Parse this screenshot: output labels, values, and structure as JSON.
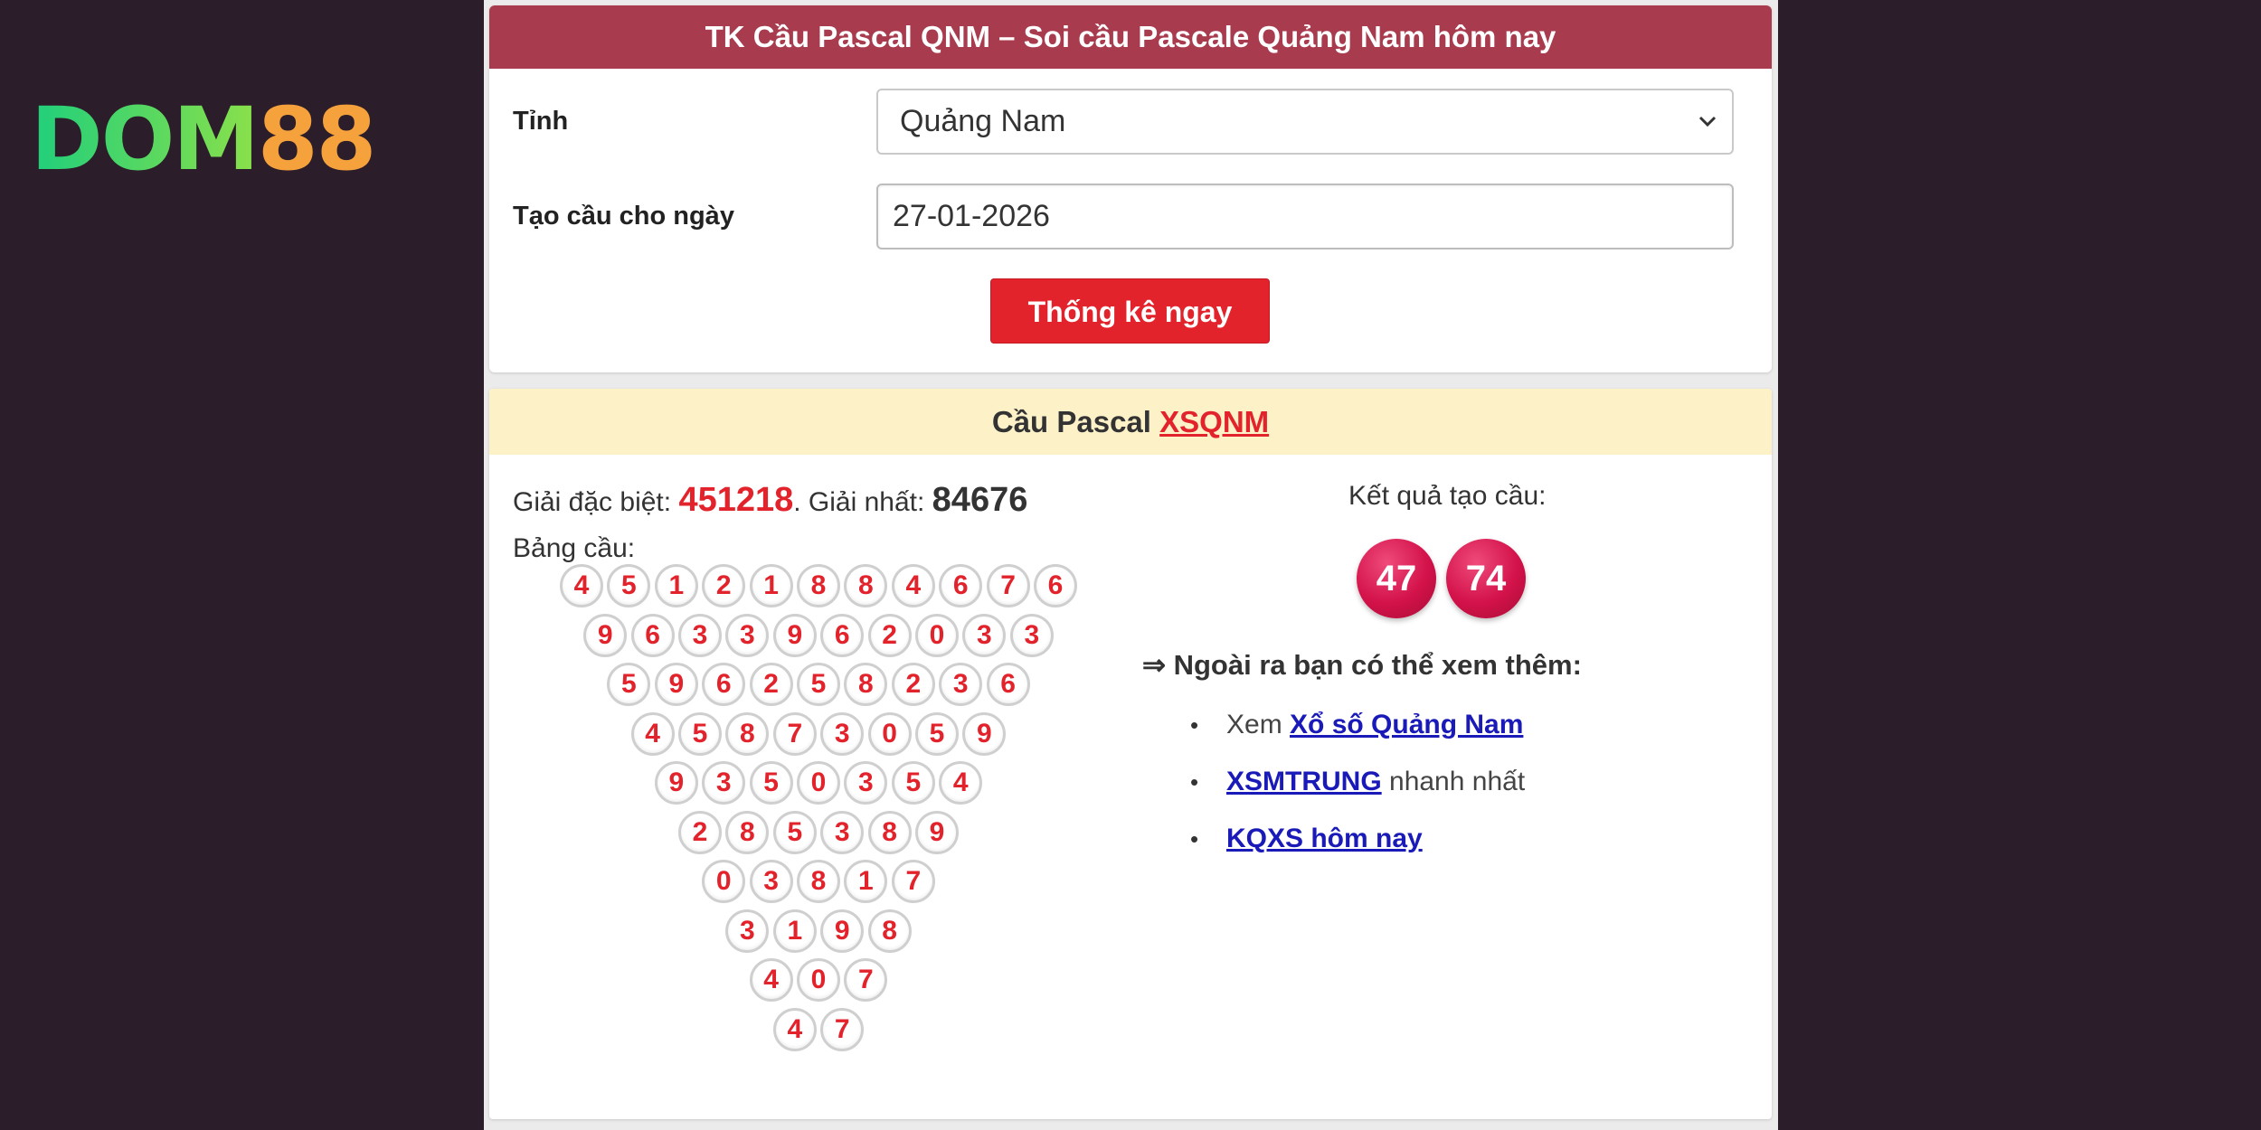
{
  "logo": {
    "part1": "DOM",
    "part2": "88"
  },
  "form": {
    "title": "TK Cầu Pascal QNM – Soi cầu Pascale Quảng Nam hôm nay",
    "province_label": "Tỉnh",
    "province_value": "Quảng Nam",
    "date_label": "Tạo cầu cho ngày",
    "date_value": "27-01-2026",
    "submit_label": "Thống kê ngay"
  },
  "result": {
    "title_prefix": "Cầu Pascal",
    "title_link": "XSQNM",
    "special_label": "Giải đặc biệt:",
    "special_value": "451218",
    "first_label": ". Giải nhất:",
    "first_value": "84676",
    "table_label": "Bảng cầu:",
    "pascal_rows": [
      [
        "4",
        "5",
        "1",
        "2",
        "1",
        "8",
        "8",
        "4",
        "6",
        "7",
        "6"
      ],
      [
        "9",
        "6",
        "3",
        "3",
        "9",
        "6",
        "2",
        "0",
        "3",
        "3"
      ],
      [
        "5",
        "9",
        "6",
        "2",
        "5",
        "8",
        "2",
        "3",
        "6"
      ],
      [
        "4",
        "5",
        "8",
        "7",
        "3",
        "0",
        "5",
        "9"
      ],
      [
        "9",
        "3",
        "5",
        "0",
        "3",
        "5",
        "4"
      ],
      [
        "2",
        "8",
        "5",
        "3",
        "8",
        "9"
      ],
      [
        "0",
        "3",
        "8",
        "1",
        "7"
      ],
      [
        "3",
        "1",
        "9",
        "8"
      ],
      [
        "4",
        "0",
        "7"
      ],
      [
        "4",
        "7"
      ]
    ],
    "outcome_label": "Kết quả tạo cầu:",
    "outcome_numbers": [
      "47",
      "74"
    ],
    "more_label": "⇒ Ngoài ra bạn có thể xem thêm:",
    "links": [
      {
        "before": "Xem ",
        "link": "Xổ số Quảng Nam",
        "after": ""
      },
      {
        "before": "",
        "link": "XSMTRUNG",
        "after": " nhanh nhất"
      },
      {
        "before": "",
        "link": "KQXS hôm nay",
        "after": ""
      }
    ]
  },
  "colors": {
    "header_red": "#a83b4d",
    "button_red": "#e2232b",
    "result_header_bg": "#fdf1c8",
    "link_blue": "#1a1ab8"
  }
}
